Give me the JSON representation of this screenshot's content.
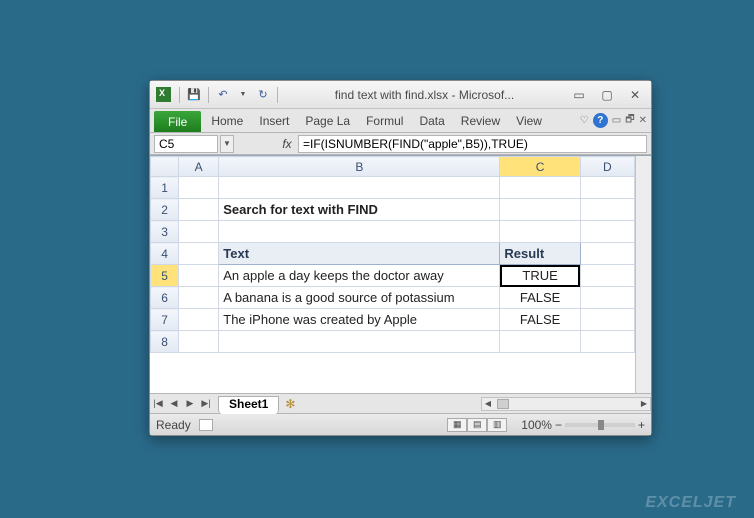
{
  "window": {
    "title": "find text with find.xlsx - Microsof..."
  },
  "qat": {
    "save": "💾",
    "undo": "↶",
    "redo": "↻"
  },
  "ribbon": {
    "file": "File",
    "tabs": [
      "Home",
      "Insert",
      "Page La",
      "Formul",
      "Data",
      "Review",
      "View"
    ]
  },
  "namebox": "C5",
  "formula": "=IF(ISNUMBER(FIND(\"apple\",B5)),TRUE)",
  "columns": [
    "A",
    "B",
    "C",
    "D"
  ],
  "rows": [
    "1",
    "2",
    "3",
    "4",
    "5",
    "6",
    "7",
    "8"
  ],
  "cells": {
    "B2": "Search for text with FIND",
    "B4": "Text",
    "C4": "Result",
    "B5": "An apple a day keeps the doctor away",
    "C5": "TRUE",
    "B6": "A banana is a good source of potassium",
    "C6": "FALSE",
    "B7": "The iPhone was created by Apple",
    "C7": "FALSE"
  },
  "sheet_tab": "Sheet1",
  "status": "Ready",
  "zoom": "100%"
}
